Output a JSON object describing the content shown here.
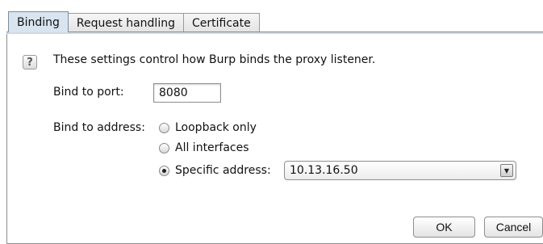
{
  "tabs": [
    {
      "label": "Binding",
      "active": true
    },
    {
      "label": "Request handling",
      "active": false
    },
    {
      "label": "Certificate",
      "active": false
    }
  ],
  "help_icon": {
    "glyph": "?"
  },
  "description": "These settings control how Burp binds the proxy listener.",
  "port": {
    "label": "Bind to port:",
    "value": "8080"
  },
  "address": {
    "label": "Bind to address:",
    "options": [
      {
        "label": "Loopback only",
        "selected": false
      },
      {
        "label": "All interfaces",
        "selected": false
      },
      {
        "label": "Specific address:",
        "selected": true
      }
    ],
    "specific_value": "10.13.16.50"
  },
  "buttons": {
    "ok": "OK",
    "cancel": "Cancel"
  }
}
